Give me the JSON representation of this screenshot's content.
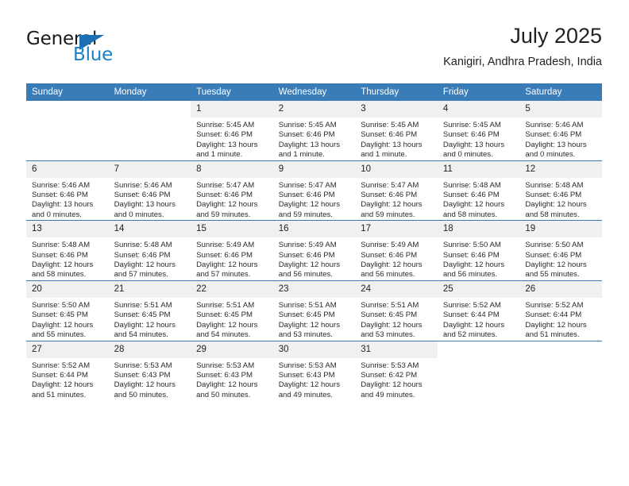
{
  "brand": {
    "name_primary": "General",
    "name_secondary": "Blue",
    "flag_icon": "flag-triangle-icon"
  },
  "header": {
    "title": "July 2025",
    "location": "Kanigiri, Andhra Pradesh, India"
  },
  "colors": {
    "header_blue": "#3a7cb8",
    "brand_blue": "#1a7fc4",
    "daynum_band": "#f0f0f0"
  },
  "weekday_headers": [
    "Sunday",
    "Monday",
    "Tuesday",
    "Wednesday",
    "Thursday",
    "Friday",
    "Saturday"
  ],
  "weeks": [
    [
      {
        "day": "",
        "empty": true,
        "sunrise": "",
        "sunset": "",
        "daylight_line1": "",
        "daylight_line2": ""
      },
      {
        "day": "",
        "empty": true,
        "sunrise": "",
        "sunset": "",
        "daylight_line1": "",
        "daylight_line2": ""
      },
      {
        "day": "1",
        "empty": false,
        "sunrise": "Sunrise: 5:45 AM",
        "sunset": "Sunset: 6:46 PM",
        "daylight_line1": "Daylight: 13 hours",
        "daylight_line2": "and 1 minute."
      },
      {
        "day": "2",
        "empty": false,
        "sunrise": "Sunrise: 5:45 AM",
        "sunset": "Sunset: 6:46 PM",
        "daylight_line1": "Daylight: 13 hours",
        "daylight_line2": "and 1 minute."
      },
      {
        "day": "3",
        "empty": false,
        "sunrise": "Sunrise: 5:45 AM",
        "sunset": "Sunset: 6:46 PM",
        "daylight_line1": "Daylight: 13 hours",
        "daylight_line2": "and 1 minute."
      },
      {
        "day": "4",
        "empty": false,
        "sunrise": "Sunrise: 5:45 AM",
        "sunset": "Sunset: 6:46 PM",
        "daylight_line1": "Daylight: 13 hours",
        "daylight_line2": "and 0 minutes."
      },
      {
        "day": "5",
        "empty": false,
        "sunrise": "Sunrise: 5:46 AM",
        "sunset": "Sunset: 6:46 PM",
        "daylight_line1": "Daylight: 13 hours",
        "daylight_line2": "and 0 minutes."
      }
    ],
    [
      {
        "day": "6",
        "empty": false,
        "sunrise": "Sunrise: 5:46 AM",
        "sunset": "Sunset: 6:46 PM",
        "daylight_line1": "Daylight: 13 hours",
        "daylight_line2": "and 0 minutes."
      },
      {
        "day": "7",
        "empty": false,
        "sunrise": "Sunrise: 5:46 AM",
        "sunset": "Sunset: 6:46 PM",
        "daylight_line1": "Daylight: 13 hours",
        "daylight_line2": "and 0 minutes."
      },
      {
        "day": "8",
        "empty": false,
        "sunrise": "Sunrise: 5:47 AM",
        "sunset": "Sunset: 6:46 PM",
        "daylight_line1": "Daylight: 12 hours",
        "daylight_line2": "and 59 minutes."
      },
      {
        "day": "9",
        "empty": false,
        "sunrise": "Sunrise: 5:47 AM",
        "sunset": "Sunset: 6:46 PM",
        "daylight_line1": "Daylight: 12 hours",
        "daylight_line2": "and 59 minutes."
      },
      {
        "day": "10",
        "empty": false,
        "sunrise": "Sunrise: 5:47 AM",
        "sunset": "Sunset: 6:46 PM",
        "daylight_line1": "Daylight: 12 hours",
        "daylight_line2": "and 59 minutes."
      },
      {
        "day": "11",
        "empty": false,
        "sunrise": "Sunrise: 5:48 AM",
        "sunset": "Sunset: 6:46 PM",
        "daylight_line1": "Daylight: 12 hours",
        "daylight_line2": "and 58 minutes."
      },
      {
        "day": "12",
        "empty": false,
        "sunrise": "Sunrise: 5:48 AM",
        "sunset": "Sunset: 6:46 PM",
        "daylight_line1": "Daylight: 12 hours",
        "daylight_line2": "and 58 minutes."
      }
    ],
    [
      {
        "day": "13",
        "empty": false,
        "sunrise": "Sunrise: 5:48 AM",
        "sunset": "Sunset: 6:46 PM",
        "daylight_line1": "Daylight: 12 hours",
        "daylight_line2": "and 58 minutes."
      },
      {
        "day": "14",
        "empty": false,
        "sunrise": "Sunrise: 5:48 AM",
        "sunset": "Sunset: 6:46 PM",
        "daylight_line1": "Daylight: 12 hours",
        "daylight_line2": "and 57 minutes."
      },
      {
        "day": "15",
        "empty": false,
        "sunrise": "Sunrise: 5:49 AM",
        "sunset": "Sunset: 6:46 PM",
        "daylight_line1": "Daylight: 12 hours",
        "daylight_line2": "and 57 minutes."
      },
      {
        "day": "16",
        "empty": false,
        "sunrise": "Sunrise: 5:49 AM",
        "sunset": "Sunset: 6:46 PM",
        "daylight_line1": "Daylight: 12 hours",
        "daylight_line2": "and 56 minutes."
      },
      {
        "day": "17",
        "empty": false,
        "sunrise": "Sunrise: 5:49 AM",
        "sunset": "Sunset: 6:46 PM",
        "daylight_line1": "Daylight: 12 hours",
        "daylight_line2": "and 56 minutes."
      },
      {
        "day": "18",
        "empty": false,
        "sunrise": "Sunrise: 5:50 AM",
        "sunset": "Sunset: 6:46 PM",
        "daylight_line1": "Daylight: 12 hours",
        "daylight_line2": "and 56 minutes."
      },
      {
        "day": "19",
        "empty": false,
        "sunrise": "Sunrise: 5:50 AM",
        "sunset": "Sunset: 6:46 PM",
        "daylight_line1": "Daylight: 12 hours",
        "daylight_line2": "and 55 minutes."
      }
    ],
    [
      {
        "day": "20",
        "empty": false,
        "sunrise": "Sunrise: 5:50 AM",
        "sunset": "Sunset: 6:45 PM",
        "daylight_line1": "Daylight: 12 hours",
        "daylight_line2": "and 55 minutes."
      },
      {
        "day": "21",
        "empty": false,
        "sunrise": "Sunrise: 5:51 AM",
        "sunset": "Sunset: 6:45 PM",
        "daylight_line1": "Daylight: 12 hours",
        "daylight_line2": "and 54 minutes."
      },
      {
        "day": "22",
        "empty": false,
        "sunrise": "Sunrise: 5:51 AM",
        "sunset": "Sunset: 6:45 PM",
        "daylight_line1": "Daylight: 12 hours",
        "daylight_line2": "and 54 minutes."
      },
      {
        "day": "23",
        "empty": false,
        "sunrise": "Sunrise: 5:51 AM",
        "sunset": "Sunset: 6:45 PM",
        "daylight_line1": "Daylight: 12 hours",
        "daylight_line2": "and 53 minutes."
      },
      {
        "day": "24",
        "empty": false,
        "sunrise": "Sunrise: 5:51 AM",
        "sunset": "Sunset: 6:45 PM",
        "daylight_line1": "Daylight: 12 hours",
        "daylight_line2": "and 53 minutes."
      },
      {
        "day": "25",
        "empty": false,
        "sunrise": "Sunrise: 5:52 AM",
        "sunset": "Sunset: 6:44 PM",
        "daylight_line1": "Daylight: 12 hours",
        "daylight_line2": "and 52 minutes."
      },
      {
        "day": "26",
        "empty": false,
        "sunrise": "Sunrise: 5:52 AM",
        "sunset": "Sunset: 6:44 PM",
        "daylight_line1": "Daylight: 12 hours",
        "daylight_line2": "and 51 minutes."
      }
    ],
    [
      {
        "day": "27",
        "empty": false,
        "sunrise": "Sunrise: 5:52 AM",
        "sunset": "Sunset: 6:44 PM",
        "daylight_line1": "Daylight: 12 hours",
        "daylight_line2": "and 51 minutes."
      },
      {
        "day": "28",
        "empty": false,
        "sunrise": "Sunrise: 5:53 AM",
        "sunset": "Sunset: 6:43 PM",
        "daylight_line1": "Daylight: 12 hours",
        "daylight_line2": "and 50 minutes."
      },
      {
        "day": "29",
        "empty": false,
        "sunrise": "Sunrise: 5:53 AM",
        "sunset": "Sunset: 6:43 PM",
        "daylight_line1": "Daylight: 12 hours",
        "daylight_line2": "and 50 minutes."
      },
      {
        "day": "30",
        "empty": false,
        "sunrise": "Sunrise: 5:53 AM",
        "sunset": "Sunset: 6:43 PM",
        "daylight_line1": "Daylight: 12 hours",
        "daylight_line2": "and 49 minutes."
      },
      {
        "day": "31",
        "empty": false,
        "sunrise": "Sunrise: 5:53 AM",
        "sunset": "Sunset: 6:42 PM",
        "daylight_line1": "Daylight: 12 hours",
        "daylight_line2": "and 49 minutes."
      },
      {
        "day": "",
        "empty": true,
        "sunrise": "",
        "sunset": "",
        "daylight_line1": "",
        "daylight_line2": ""
      },
      {
        "day": "",
        "empty": true,
        "sunrise": "",
        "sunset": "",
        "daylight_line1": "",
        "daylight_line2": ""
      }
    ]
  ]
}
